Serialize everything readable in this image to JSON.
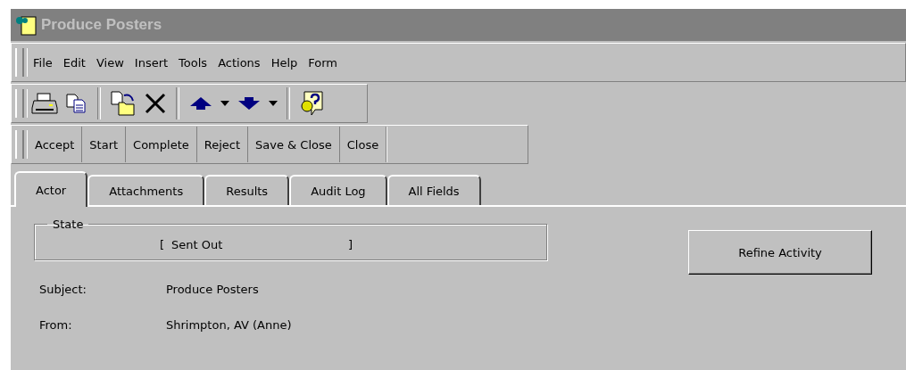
{
  "window": {
    "title": "Produce Posters"
  },
  "menu": [
    "File",
    "Edit",
    "View",
    "Insert",
    "Tools",
    "Actions",
    "Help",
    "Form"
  ],
  "actions": [
    "Accept",
    "Start",
    "Complete",
    "Reject",
    "Save & Close",
    "Close"
  ],
  "tabs": [
    {
      "label": "Actor",
      "selected": true
    },
    {
      "label": "Attachments",
      "selected": false
    },
    {
      "label": "Results",
      "selected": false
    },
    {
      "label": "Audit Log",
      "selected": false
    },
    {
      "label": "All Fields",
      "selected": false
    }
  ],
  "state": {
    "label": "State",
    "open_bracket": "[",
    "value": "Sent Out",
    "close_bracket": "]"
  },
  "refine_button": "Refine Activity",
  "fields": [
    {
      "label": "Subject:",
      "value": "Produce Posters"
    },
    {
      "label": "From:",
      "value": "Shrimpton, AV (Anne)"
    }
  ]
}
